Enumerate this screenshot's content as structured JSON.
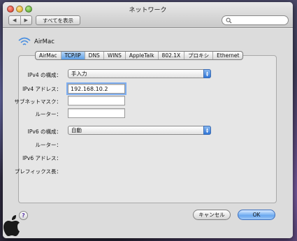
{
  "window": {
    "title": "ネットワーク",
    "show_all_label": "すべてを表示",
    "search_placeholder": ""
  },
  "header": {
    "service_name": "AirMac"
  },
  "tabs": [
    {
      "label": "AirMac",
      "active": false
    },
    {
      "label": "TCP/IP",
      "active": true
    },
    {
      "label": "DNS",
      "active": false
    },
    {
      "label": "WINS",
      "active": false
    },
    {
      "label": "AppleTalk",
      "active": false
    },
    {
      "label": "802.1X",
      "active": false
    },
    {
      "label": "プロキシ",
      "active": false
    },
    {
      "label": "Ethernet",
      "active": false
    }
  ],
  "ipv4": {
    "configure_label": "IPv4 の構成：",
    "configure_value": "手入力",
    "address_label": "IPv4 アドレス：",
    "address_value": "192.168.10.2",
    "subnet_label": "サブネットマスク：",
    "subnet_value": "",
    "router_label": "ルーター：",
    "router_value": ""
  },
  "ipv6": {
    "configure_label": "IPv6 の構成：",
    "configure_value": "自動",
    "router_label": "ルーター：",
    "address_label": "IPv6 アドレス：",
    "prefix_label": "プレフィックス長："
  },
  "footer": {
    "help_label": "?",
    "cancel_label": "キャンセル",
    "ok_label": "OK"
  },
  "colors": {
    "accent": "#5d9fe6",
    "window_bg": "#e8e8e8"
  }
}
